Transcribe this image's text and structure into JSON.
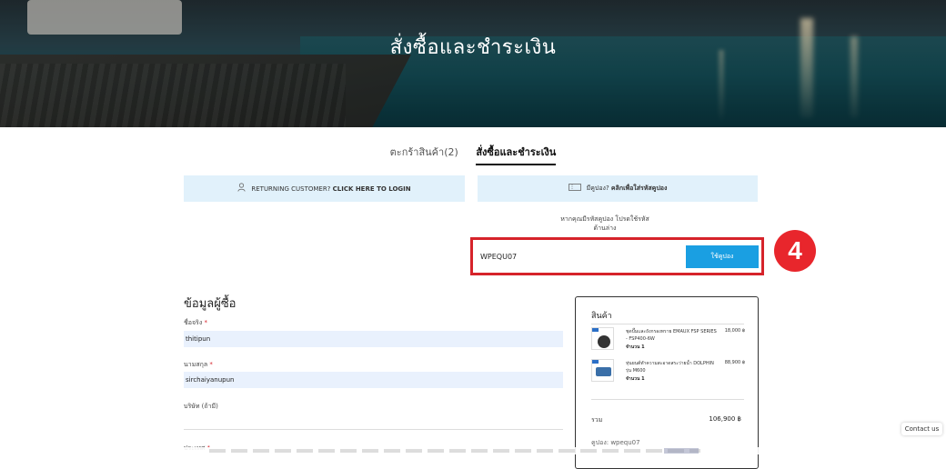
{
  "hero": {
    "title": "สั่งซื้อและชำระเงิน"
  },
  "tabs": [
    {
      "label": "ตะกร้าสินค้า(2)"
    },
    {
      "label": "สั่งซื้อและชำระเงิน"
    }
  ],
  "notices": {
    "returning_prefix": "RETURNING CUSTOMER? ",
    "returning_link": "CLICK HERE TO LOGIN",
    "coupon_prefix": "มีคูปอง? ",
    "coupon_link": "คลิกเพื่อใส่รหัสคูปอง"
  },
  "coupon": {
    "hint_line1": "หากคุณมีรหัสคูปอง โปรดใช้รหัส",
    "hint_line2": "ด้านล่าง",
    "value": "WPEQU07",
    "button_label": "ใช้คูปอง",
    "step_number": "4"
  },
  "form": {
    "title": "ข้อมูลผู้ซื้อ",
    "first_name_label": "ชื่อจริง",
    "first_name_value": "thitipun",
    "last_name_label": "นามสกุล",
    "last_name_value": "sirchaiyanupun",
    "company_label": "บริษัท (ถ้ามี)",
    "country_label": "ประเทศ",
    "required_mark": "*"
  },
  "summary": {
    "heading": "สินค้า",
    "items": [
      {
        "name": "ชุดปั๊มและถังกรองทราย EMAUX FSP SERIES - FSP400-6W",
        "price": "18,000 ฿",
        "qty": "จำนวน 1"
      },
      {
        "name": "หุ่นยนต์ทำความสะอาดสระว่ายน้ำ DOLPHIN รุ่น M600",
        "price": "88,900 ฿",
        "qty": "จำนวน 1"
      }
    ],
    "subtotal_label": "รวม",
    "subtotal_value": "106,900 ฿",
    "coupon_line": "คูปอง: wpequ07"
  },
  "widgets": {
    "contact_label": "Contact us"
  },
  "colors": {
    "accent_blue": "#1a9fe2",
    "notice_bg": "#e1f1fb",
    "highlight_red": "#d6232a"
  }
}
